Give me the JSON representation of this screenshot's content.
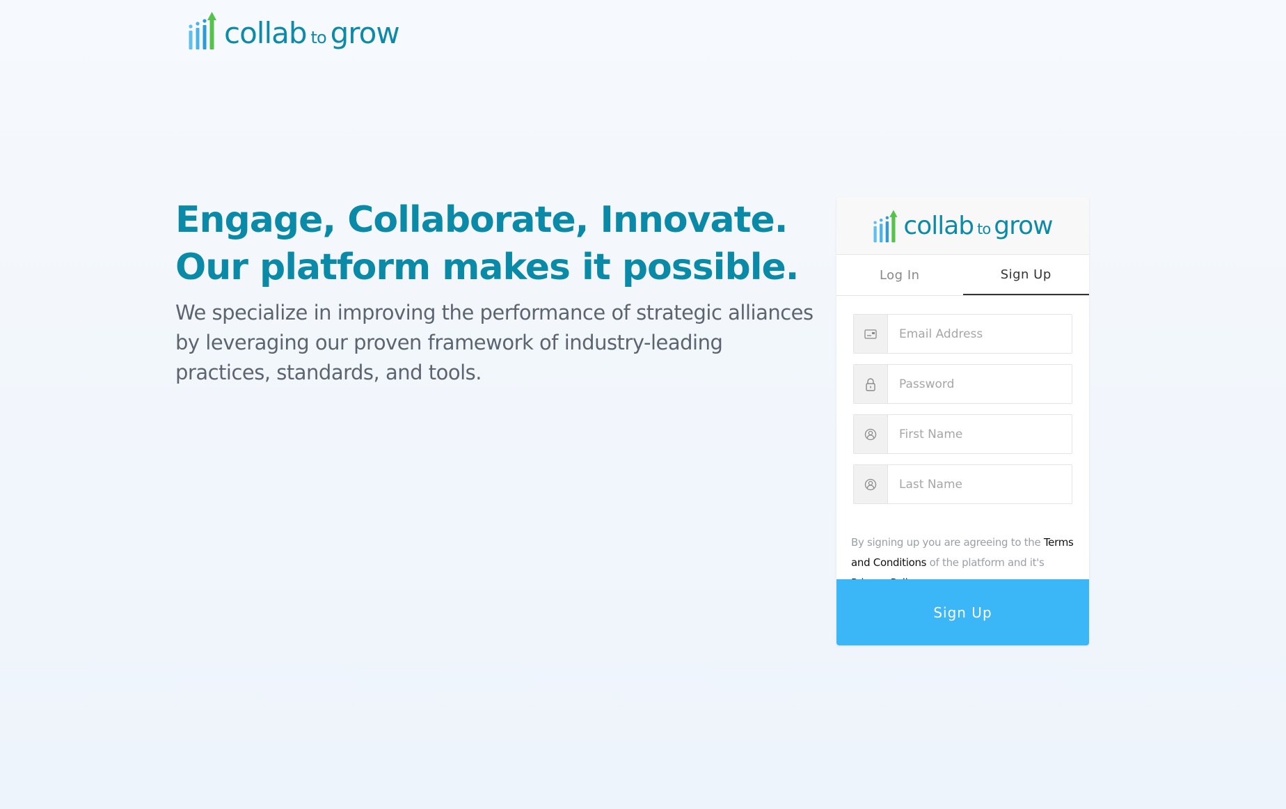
{
  "brand": {
    "word1": "collab",
    "word2": "to",
    "word3": "grow",
    "colors": {
      "text": "#0e8aa9",
      "bar_light": "#5fc0ef",
      "bar_dark": "#2e9bd6",
      "arrow": "#56c24b"
    }
  },
  "hero": {
    "headline_line1": "Engage, Collaborate, Innovate.",
    "headline_line2": "Our platform makes it possible.",
    "description": "We specialize in improving the performance of strategic alliances by leveraging our proven framework of industry-leading practices, standards, and tools."
  },
  "auth_card": {
    "tabs": [
      {
        "label": "Log In",
        "active": false
      },
      {
        "label": "Sign Up",
        "active": true
      }
    ],
    "fields": [
      {
        "placeholder": "Email Address",
        "value": "",
        "icon": "id-card-icon"
      },
      {
        "placeholder": "Password",
        "value": "",
        "icon": "lock-icon"
      },
      {
        "placeholder": "First Name",
        "value": "",
        "icon": "user-icon"
      },
      {
        "placeholder": "Last Name",
        "value": "",
        "icon": "user-icon"
      }
    ],
    "terms": {
      "prefix": "By signing up you are agreeing to the ",
      "terms_link": "Terms and Conditions",
      "middle": " of the platform and it's ",
      "privacy_link": "Privacy Policy",
      "suffix": "."
    },
    "submit_label": "Sign Up",
    "accent_color": "#3bb6f6"
  }
}
